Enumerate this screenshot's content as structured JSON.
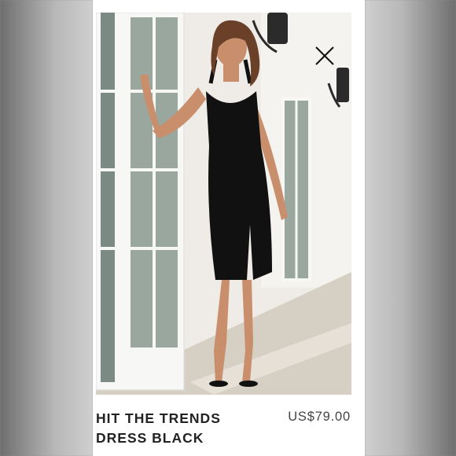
{
  "product": {
    "name": "HIT THE TRENDS\nDRESS BLACK",
    "price": "US$79.00"
  },
  "photo": {
    "description_hidden": false
  },
  "icons": {
    "close": "close-icon"
  },
  "colors": {
    "background": "#8c8c8c",
    "card": "#ffffff",
    "dress": "#111111",
    "text": "#222222"
  }
}
